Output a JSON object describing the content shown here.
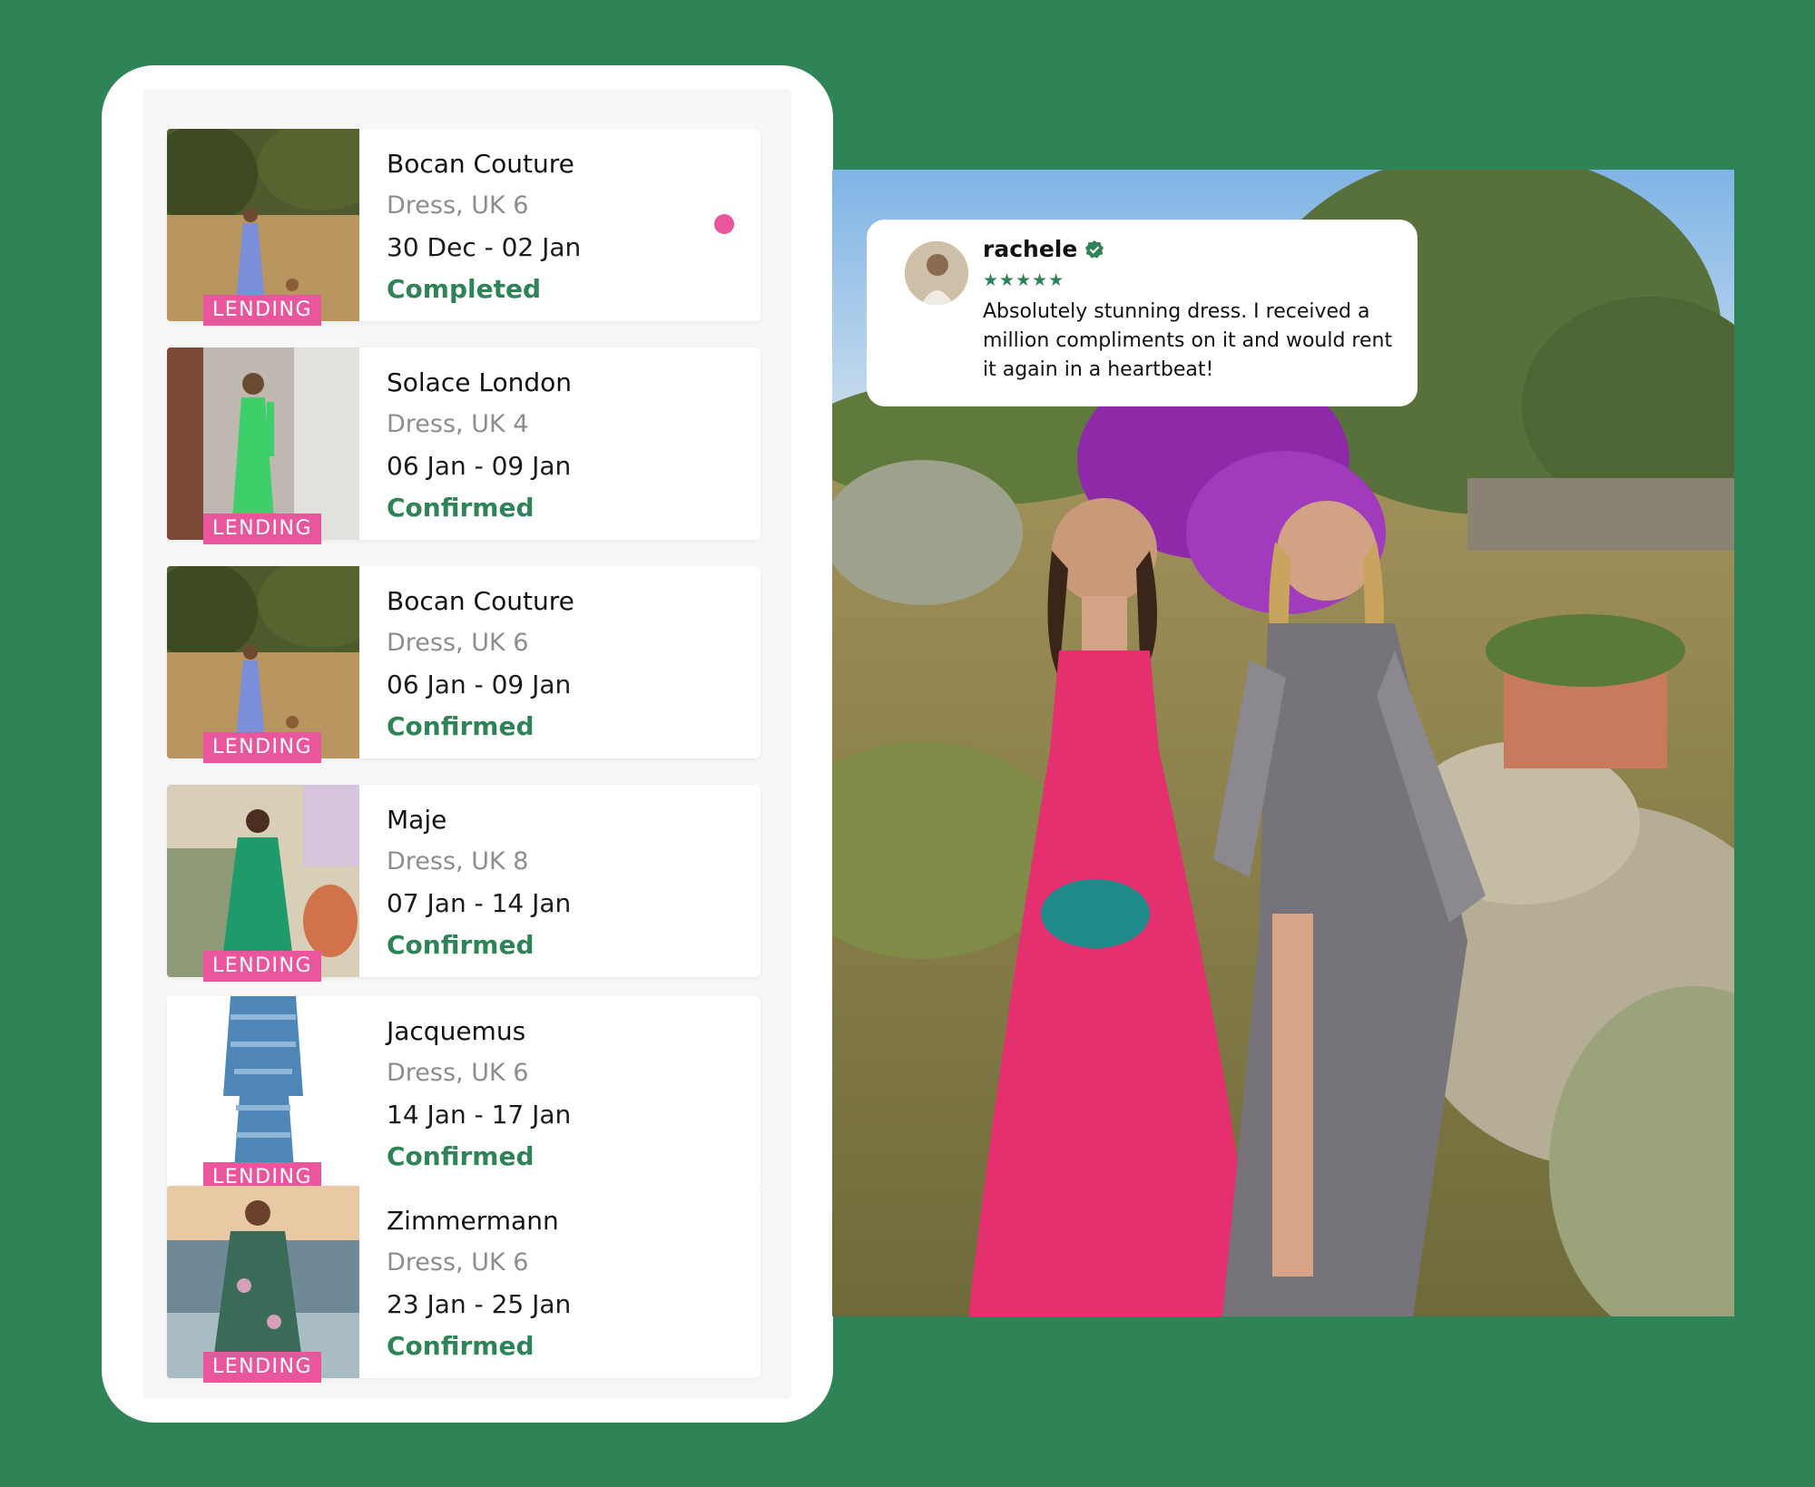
{
  "colors": {
    "background": "#2e8457",
    "accent_pink": "#e9569e",
    "status_green": "#2e8457",
    "size_gray": "#8d8d8d"
  },
  "bookings": [
    {
      "brand": "Bocan Couture",
      "size": "Dress, UK 6",
      "dates": "30 Dec - 02 Jan",
      "status": "Completed",
      "badge": "LENDING",
      "unread": true
    },
    {
      "brand": "Solace London",
      "size": "Dress, UK 4",
      "dates": "06 Jan - 09 Jan",
      "status": "Confirmed",
      "badge": "LENDING",
      "unread": false
    },
    {
      "brand": "Bocan Couture",
      "size": "Dress, UK 6",
      "dates": "06 Jan - 09 Jan",
      "status": "Confirmed",
      "badge": "LENDING",
      "unread": false
    },
    {
      "brand": "Maje",
      "size": "Dress, UK 8",
      "dates": "07 Jan - 14 Jan",
      "status": "Confirmed",
      "badge": "LENDING",
      "unread": false
    },
    {
      "brand": "Jacquemus",
      "size": "Dress, UK 6",
      "dates": "14 Jan - 17 Jan",
      "status": "Confirmed",
      "badge": "LENDING",
      "unread": false
    },
    {
      "brand": "Zimmermann",
      "size": "Dress, UK 6",
      "dates": "23 Jan - 25 Jan",
      "status": "Confirmed",
      "badge": "LENDING",
      "unread": false
    }
  ],
  "review": {
    "user": "rachele",
    "stars": "★★★★★",
    "rating": 5,
    "text": "Absolutely stunning dress. I received a million compliments on it and would rent it again in a heartbeat!"
  },
  "icons": {
    "verified": "verified-badge-icon",
    "unread": "unread-dot-icon"
  }
}
